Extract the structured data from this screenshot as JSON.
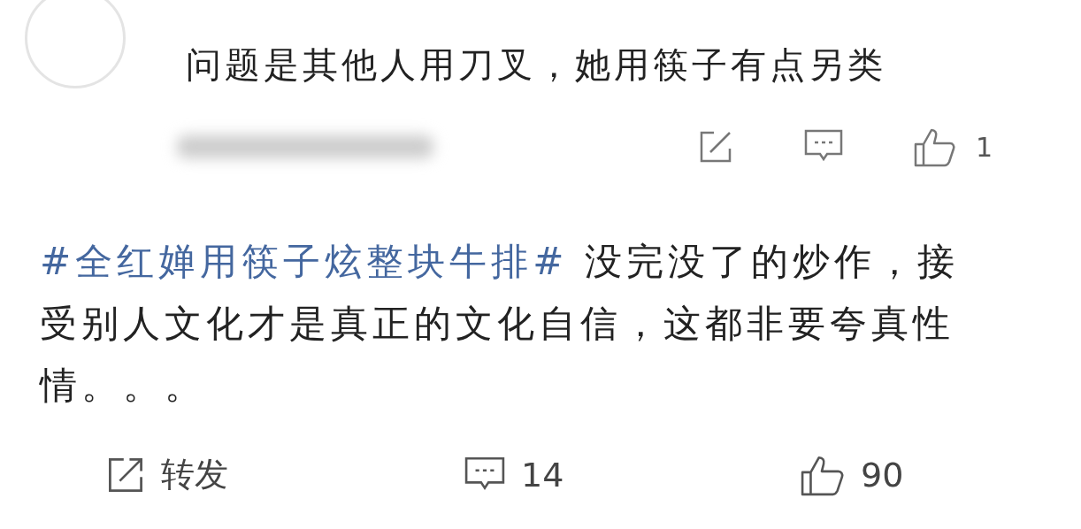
{
  "reply": {
    "text": "问题是其他人用刀叉，她用筷子有点另类",
    "likes": "1"
  },
  "post": {
    "hashtag": "#全红婵用筷子炫整块牛排#",
    "text": "没完没了的炒作，接受别人文化才是真正的文化自信，这都非要夸真性情。。。"
  },
  "actions": [
    {
      "kind": "share",
      "label": "转发"
    },
    {
      "kind": "comment",
      "label": "14"
    },
    {
      "kind": "like",
      "label": "90"
    }
  ]
}
